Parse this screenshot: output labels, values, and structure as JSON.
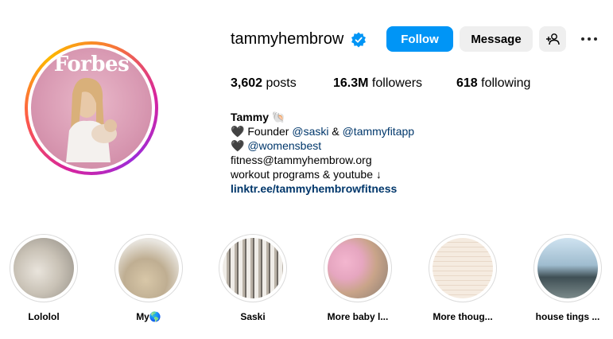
{
  "profile": {
    "username": "tammyhembrow",
    "avatar_caption": "Forbes",
    "follow_label": "Follow",
    "message_label": "Message",
    "posts_count": "3,602",
    "posts_label": "posts",
    "followers_count": "16.3M",
    "followers_label": "followers",
    "following_count": "618",
    "following_label": "following"
  },
  "bio": {
    "name": "Tammy 🐚",
    "line1_prefix": "🖤 Founder ",
    "line1_mention1": "@saski",
    "line1_sep": " & ",
    "line1_mention2": "@tammyfitapp",
    "line2_prefix": "🖤 ",
    "line2_mention": "@womensbest",
    "line3": "fitness@tammyhembrow.org",
    "line4": "workout programs & youtube ↓",
    "link": "linktr.ee/tammyhembrowfitness"
  },
  "highlights": [
    {
      "label": "Lololol"
    },
    {
      "label": "My🌎"
    },
    {
      "label": "Saski"
    },
    {
      "label": "More baby l..."
    },
    {
      "label": "More thoug..."
    },
    {
      "label": "house tings ..."
    }
  ],
  "colors": {
    "accent": "#0095f6",
    "link": "#00376b",
    "button_secondary": "#efefef"
  },
  "icons": {
    "verified": "verified-badge-icon",
    "add_user": "add-user-icon",
    "more": "more-options-icon"
  }
}
